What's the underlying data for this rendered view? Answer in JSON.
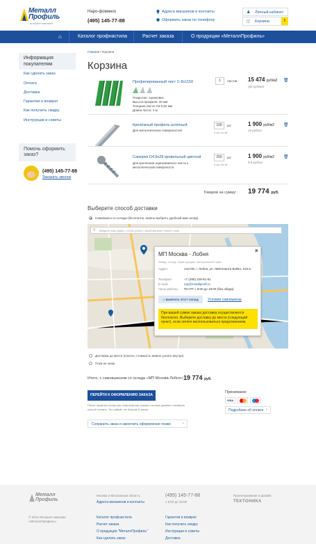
{
  "header": {
    "logo_text_1": "Металл",
    "logo_text_2": "Профиль",
    "logo_sub": "интернет-магазин",
    "city": "Наро-фоминск",
    "phone": "(495) 145-77-88",
    "stores_link": "Адреса магазинов и контакты",
    "phone_order_link": "Оформить заказ по телефону",
    "cabinet": "Личный кабинет",
    "cart": "Корзина",
    "cart_count": "5"
  },
  "nav": {
    "items": [
      "Каталог профнастила",
      "Расчет заказа",
      "О продукции «МеталлПрофиль»"
    ]
  },
  "sidebar": {
    "title": "Информация покупателям",
    "items": [
      "Как сделать заказ",
      "Оплата",
      "Доставка",
      "Гарантии и возврат",
      "Как получить скидку",
      "Инструкции и советы"
    ],
    "help_title": "Помочь оформить заказ?",
    "help_phone": "(495) 145-77-88",
    "help_link": "Заказать звонок"
  },
  "breadcrumb": {
    "home": "Главная",
    "sep": "/",
    "current": "Корзина"
  },
  "page_title": "Корзина",
  "products": [
    {
      "title": "Профилированный лист С-8х1150",
      "details": [
        "Покрытие: оцинковка",
        "Высота профиля: 20 мм",
        "Толщина листа: 04-0,52 мм",
        "Длина листа: 2 м"
      ],
      "qty": "1",
      "unit": "листов",
      "unit_note": "",
      "price": "15 474",
      "price_unit": "руб/м2",
      "sub": "(66 руб/м2)"
    },
    {
      "title": "Крепёжный профиль шляпный",
      "details": [
        "Для металлических поверхностей"
      ],
      "qty": "100",
      "unit": "шт.",
      "unit_note": "1 шт. по м/",
      "price": "1 900",
      "price_unit": "руб/м2",
      "sub": "19 руб/шт"
    },
    {
      "title": "Саморез D4.8x28 кровельный цветной",
      "details": [
        "Для крепления оцинкованного листа к",
        "металлической поверхности"
      ],
      "qty": "200",
      "unit": "шт.",
      "unit_note": "4 шт. на м/",
      "price": "1 900",
      "price_unit": "руб/м2",
      "sub": "9,5 руб/шт"
    }
  ],
  "total": {
    "label": "Товаров на сумму:",
    "value": "19 774",
    "currency": "руб."
  },
  "delivery": {
    "title": "Выберите способ доставки",
    "opt1": "Самовывоз со склада (бесплатно, можно выбрать удобный вам склад)",
    "search_placeholder": "Введите ваш адрес, чтобы узнать, какой магазин ближе к вам",
    "opt2": "Доставка до места (платно, стоимость можно узнать внутри)",
    "opt3": "Пока не знаю"
  },
  "popup": {
    "title": "МП Москва - Лобня",
    "tags": "Завод, Склад, Офис продаж, Центральный офис",
    "addr_label": "Адрес:",
    "addr": "141730, г. Лобня, ул. Лейтенанта Бойко, 104-а",
    "phone_label": "Телефон:",
    "phone": "+7 (495) 225-61-51",
    "email_label": "E-mail:",
    "email": "mp@metallprofil.ru",
    "hours_label": "Часы работы:",
    "hours": "ПН-ПТ с 9:00 до 18:00 (без обеда)",
    "btn": "ВЫБРАТЬ ЭТОТ СКЛАД",
    "conditions": "Условия самовывоза",
    "note": "При вашей сумме заказа доставка осуществляется бесплатно. Выберите доставку до места (следующий пункт), если хотите воспользоваться предложением."
  },
  "summary": {
    "label": "Итого, с самовывозом со склада «МП Москва-Лобня»:",
    "value": "19 774",
    "currency": "руб."
  },
  "checkout": {
    "btn": "ПЕРЕЙТИ К ОФОРМЛЕНИЮ ЗАКАЗА",
    "note": "После нажатия кнопки мы попросим вас указать личные данные и выбрать способ оплаты. Это займёт не больше 5 минут.",
    "accept": "Принимаем:",
    "more": "Подробнее об оплате",
    "save": "Сохранить заказ и закончить оформление позже"
  },
  "footer": {
    "region": "Москва и Московская область",
    "stores": "Адреса магазинов и контакты",
    "phone": "(495) 145-77-88",
    "hours": "с 9:00 до 19:00",
    "design_label": "Проектирование и дизайн:",
    "design": "ТЕКТОНИКА",
    "copyright": "© 2014 Интернет-магазин «МеталлПрофиль»",
    "col1": [
      "Каталог профнастила",
      "Расчет заказа",
      "О продукции \"МеталлПрофиль\"",
      "Как сделать заказ"
    ],
    "col2": [
      "Гарантии и возврат",
      "Как получить скидку",
      "Инструкции и советы",
      "Доставка"
    ]
  },
  "colors": {
    "brand": "#1c4f9c",
    "accent": "#ffe000"
  }
}
